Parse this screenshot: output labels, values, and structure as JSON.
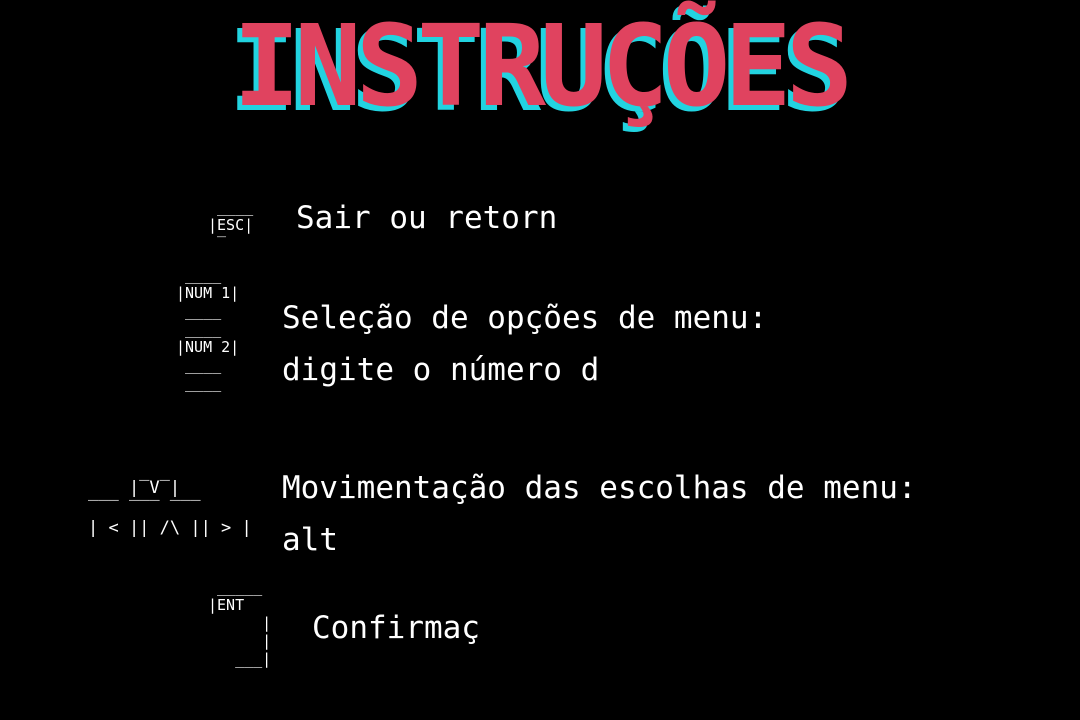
{
  "title": "INSTRUÇÕES",
  "colors": {
    "background": "#000000",
    "title_main": "#e0435f",
    "title_shadow": "#22d3e0",
    "text": "#ffffff"
  },
  "instructions": [
    {
      "key_art": " ____\n|ESC|\n ‾",
      "lines": [
        "Sair ou retorn"
      ]
    },
    {
      "key_art": " ____\n|NUM 1|\n ____\n ____\n|NUM 2|\n ____\n ____",
      "lines": [
        "Seleção de opções de menu:",
        "digite o número d"
      ]
    },
    {
      "key_art": "    |‾V‾|\n‾‾‾ ‾‾‾ ‾‾‾\n| < || /\\ || > |",
      "lines": [
        "Movimentação das escolhas de menu:",
        "alt"
      ]
    },
    {
      "key_art": " _____\n|ENT\n      |\n      |\n   ___|",
      "lines": [
        "Confirmaç"
      ]
    }
  ]
}
